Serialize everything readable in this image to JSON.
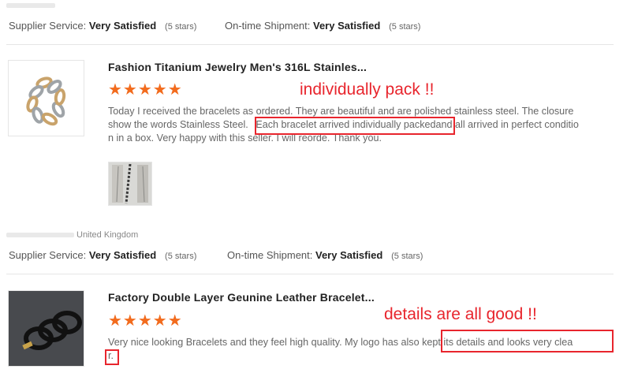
{
  "reviews": [
    {
      "supplier_label": "Supplier Service:",
      "supplier_value": "Very Satisfied",
      "supplier_stars": "(5 stars)",
      "shipment_label": "On-time Shipment:",
      "shipment_value": "Very Satisfied",
      "shipment_stars": "(5 stars)",
      "product_title": "Fashion Titanium Jewelry Men's 316L Stainles...",
      "stars": "★★★★★",
      "text_line1": "Today I received the bracelets as ordered.  They are beautiful  and are polished stainless steel.  The closure",
      "text_line2a": "show the words Stainless Steel.",
      "text_line2b": "Each bracelet arrived individually packed",
      "text_line2c": "and all arrived in perfect conditio",
      "text_line3": "n in a box.  Very happy with this seller.  I will reorde.  Thank you.",
      "annotation": "individually pack !!"
    },
    {
      "country": "United Kingdom",
      "supplier_label": "Supplier Service:",
      "supplier_value": "Very Satisfied",
      "supplier_stars": "(5 stars)",
      "shipment_label": "On-time Shipment:",
      "shipment_value": "Very Satisfied",
      "shipment_stars": "(5 stars)",
      "product_title": "Factory Double Layer Geunine Leather Bracelet...",
      "stars": "★★★★★",
      "text_line1a": "Very nice looking Bracelets and they feel high quality. My logo has also",
      "text_line1b": "kept its details and looks very clea",
      "text_line2": "r.",
      "annotation": "details are all good !!"
    }
  ],
  "colors": {
    "accent": "#f26b1d",
    "annotation": "#e8252d"
  }
}
